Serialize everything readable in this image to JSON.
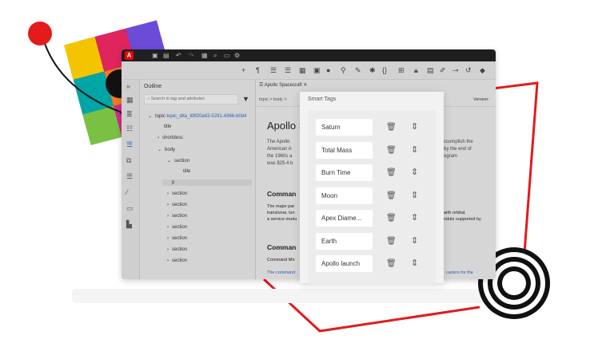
{
  "app": {
    "title_icons": [
      "save-icon",
      "save-as-icon",
      "undo-icon",
      "redo-icon",
      "document-icon",
      "find-icon",
      "preview-icon",
      "settings-icon"
    ]
  },
  "toolbar": {
    "icons": [
      "add-icon",
      "paragraph-icon",
      "ordered-list-icon",
      "unordered-list-icon",
      "table-icon",
      "image-icon",
      "media-icon",
      "link-icon",
      "cross-reference-icon",
      "symbol-icon",
      "code-icon",
      "insert-element-icon",
      "lock-icon",
      "review-icon",
      "edit-icon",
      "tag-icon",
      "history-icon",
      "label-icon"
    ]
  },
  "rail": {
    "icons": [
      "expand-icon",
      "grid-icon",
      "database-icon",
      "toc-icon",
      "outline-icon",
      "components-icon",
      "list-icon",
      "variables-icon",
      "media-panel-icon",
      "files-icon"
    ]
  },
  "outline": {
    "title": "Outline",
    "search_placeholder": "Search in tag and attributes",
    "nodes": [
      {
        "label": "topic",
        "id": "topic_dita_89f20a63-5291-4366-b0d4",
        "depth": 0,
        "chev": "v"
      },
      {
        "label": "title",
        "depth": 1,
        "chev": ""
      },
      {
        "label": "shortdesc",
        "depth": 1,
        "chev": ">"
      },
      {
        "label": "body",
        "depth": 1,
        "chev": "v"
      },
      {
        "label": "section",
        "depth": 2,
        "chev": "v"
      },
      {
        "label": "title",
        "depth": 3,
        "chev": ""
      },
      {
        "label": "p",
        "depth": 3,
        "chev": "",
        "selected": true
      },
      {
        "label": "section",
        "depth": 2,
        "chev": ">"
      },
      {
        "label": "section",
        "depth": 2,
        "chev": ">"
      },
      {
        "label": "section",
        "depth": 2,
        "chev": ">"
      },
      {
        "label": "section",
        "depth": 2,
        "chev": ">"
      },
      {
        "label": "section",
        "depth": 2,
        "chev": ">"
      },
      {
        "label": "section",
        "depth": 2,
        "chev": ">"
      },
      {
        "label": "section",
        "depth": 2,
        "chev": ">"
      }
    ]
  },
  "editor": {
    "tab": "Apollo Spacecraft",
    "breadcrumb": "topic  >  body  >",
    "version_label": "Version:",
    "heading": "Apollo S",
    "para1": [
      "The Apollo",
      "American A",
      "the 1960s a",
      "was $25.4 b"
    ],
    "para1_right": [
      "ccomplish the",
      "by the end of",
      "ogram"
    ],
    "h2a": "Comman",
    "para2": [
      "The major par",
      "translunar, lun",
      "a service modu"
    ],
    "para2_right": [
      "arth orbital,",
      "odule supported by"
    ],
    "h2b": "Comman",
    "para3": "Command Mo",
    "link_left": "The command",
    "link_right": "carters for the"
  },
  "smart_tags": {
    "title": "Smart Tags",
    "tags": [
      "Saturn",
      "Total Mass",
      "Burn Time",
      "Moon",
      "Apex Diame...",
      "Earth",
      "Apollo launch"
    ]
  },
  "colors": {
    "accent": "#e31b1b",
    "title_bar": "#1f1f1f",
    "logo": "#ee0000"
  }
}
